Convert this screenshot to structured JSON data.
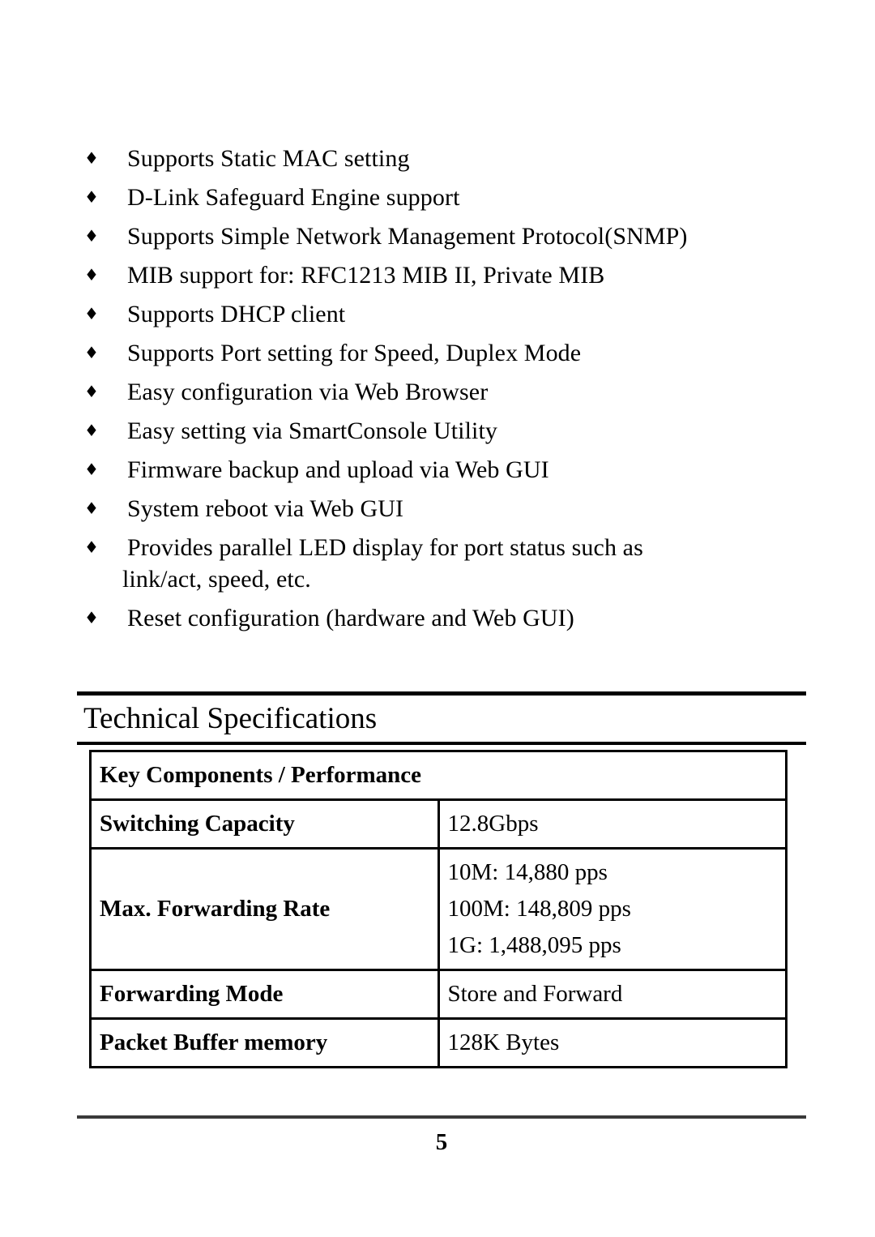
{
  "document": {
    "bullet_glyph": "♦",
    "features": [
      {
        "text": "Supports Static MAC setting"
      },
      {
        "text": "D-Link Safeguard Engine support"
      },
      {
        "text": "Supports Simple Network Management Protocol(SNMP)"
      },
      {
        "text": "MIB support for: RFC1213 MIB II, Private MIB"
      },
      {
        "text": "Supports DHCP client"
      },
      {
        "text": "Supports Port setting for Speed, Duplex Mode"
      },
      {
        "text": "Easy configuration via Web Browser"
      },
      {
        "text": "Easy setting via SmartConsole Utility"
      },
      {
        "text": "Firmware backup and upload via Web GUI"
      },
      {
        "text": "System reboot via Web GUI"
      },
      {
        "text": "Provides parallel LED display for port status such as",
        "continuation": "link/act, speed, etc."
      },
      {
        "text": "Reset configuration (hardware and Web GUI)"
      }
    ],
    "section": {
      "title": "Technical Specifications"
    },
    "spec_table": {
      "header": "Key Components / Performance",
      "rows": [
        {
          "label": "Switching Capacity",
          "value": "12.8Gbps"
        },
        {
          "label": "Max. Forwarding Rate",
          "value_lines": [
            "10M: 14,880 pps",
            "100M: 148,809 pps",
            "1G: 1,488,095 pps"
          ]
        },
        {
          "label": "Forwarding Mode",
          "value": "Store and Forward"
        },
        {
          "label": "Packet Buffer memory",
          "value": "128K Bytes"
        }
      ]
    },
    "footer": {
      "page_number": "5"
    }
  }
}
